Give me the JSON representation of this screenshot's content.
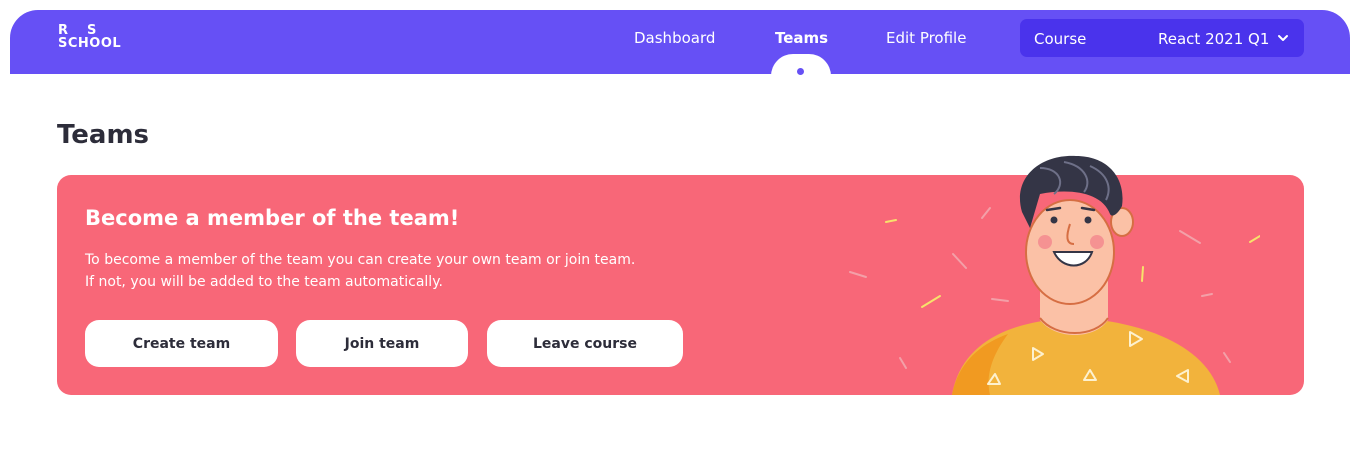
{
  "logo": {
    "top_r": "R",
    "top_s": "S",
    "bottom": "SCHOOL"
  },
  "nav": {
    "items": [
      {
        "label": "Dashboard"
      },
      {
        "label": "Teams"
      },
      {
        "label": "Edit Profile"
      }
    ],
    "active_index": 1
  },
  "course_select": {
    "label": "Course",
    "value": "React 2021 Q1"
  },
  "page": {
    "title": "Teams"
  },
  "banner": {
    "heading": "Become a member of the team!",
    "text_line1": "To become a member of the team you can create your own team or join team.",
    "text_line2": "If not, you will be added to the team automatically.",
    "buttons": [
      {
        "label": "Create team"
      },
      {
        "label": "Join team"
      },
      {
        "label": "Leave course"
      }
    ]
  },
  "colors": {
    "nav_bg": "#6650f5",
    "course_bg": "#4a33ec",
    "banner_bg": "#f86778",
    "title_text": "#2d2d3a",
    "shirt": "#f2b33c",
    "skin": "#fbc1a6",
    "hair": "#343546"
  }
}
